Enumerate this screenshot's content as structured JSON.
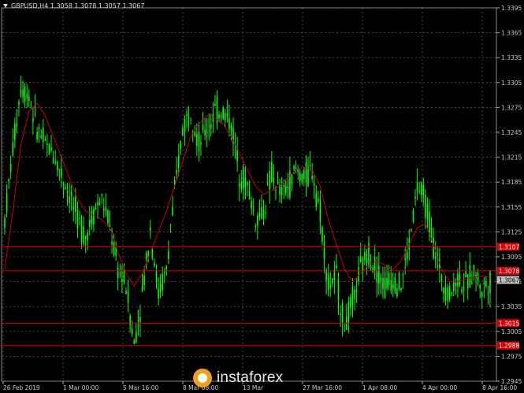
{
  "symbol": {
    "name": "GBPUSD,H4",
    "open": "1.3058",
    "high": "1.3078",
    "low": "1.3057",
    "close": "1.3067"
  },
  "watermark": "instaforex",
  "colors": {
    "background": "#000000",
    "grid": "#707070",
    "candle": "#00ff00",
    "ma": "#cc0000",
    "level_line": "#e00000",
    "level_tag": "#dd0000",
    "price_tag": "#c0c0c0",
    "axis_text": "#c8c8c8"
  },
  "chart_data": {
    "type": "line",
    "ylim": [
      1.2945,
      1.3395
    ],
    "y_ticks": [
      "1.3395",
      "1.3365",
      "1.3335",
      "1.3305",
      "1.3275",
      "1.3245",
      "1.3215",
      "1.3185",
      "1.3155",
      "1.3125",
      "1.3095",
      "1.3065",
      "1.3035",
      "1.3005",
      "1.2975",
      "1.2945"
    ],
    "x_ticks": [
      "26 Feb 2019",
      "1 Mar 00:00",
      "5 Mar 16:00",
      "8 Mar 08:00",
      "13 Mar",
      "27 Mar 16:00",
      "1 Apr 08:00",
      "4 Apr 00:00",
      "8 Apr 16:00"
    ],
    "grid": true,
    "levels": [
      {
        "value": 1.3107,
        "label": "1.3107"
      },
      {
        "value": 1.3078,
        "label": "1.3078"
      },
      {
        "value": 1.3015,
        "label": "1.3015"
      },
      {
        "value": 1.2988,
        "label": "1.2988"
      }
    ],
    "current_price": {
      "value": 1.3067,
      "label": "1.3067"
    },
    "price_path": [
      [
        0,
        1.314
      ],
      [
        4,
        1.3225
      ],
      [
        8,
        1.33
      ],
      [
        12,
        1.329
      ],
      [
        16,
        1.325
      ],
      [
        20,
        1.323
      ],
      [
        24,
        1.322
      ],
      [
        28,
        1.3195
      ],
      [
        32,
        1.317
      ],
      [
        36,
        1.314
      ],
      [
        40,
        1.312
      ],
      [
        44,
        1.315
      ],
      [
        48,
        1.3165
      ],
      [
        52,
        1.313
      ],
      [
        56,
        1.308
      ],
      [
        60,
        1.306
      ],
      [
        64,
        1.299
      ],
      [
        68,
        1.305
      ],
      [
        72,
        1.313
      ],
      [
        76,
        1.305
      ],
      [
        80,
        1.308
      ],
      [
        84,
        1.317
      ],
      [
        88,
        1.325
      ],
      [
        92,
        1.3275
      ],
      [
        96,
        1.323
      ],
      [
        100,
        1.325
      ],
      [
        104,
        1.327
      ],
      [
        108,
        1.327
      ],
      [
        112,
        1.3255
      ],
      [
        116,
        1.32
      ],
      [
        120,
        1.318
      ],
      [
        124,
        1.314
      ],
      [
        128,
        1.315
      ],
      [
        132,
        1.3195
      ],
      [
        136,
        1.317
      ],
      [
        140,
        1.318
      ],
      [
        144,
        1.32
      ],
      [
        148,
        1.319
      ],
      [
        152,
        1.32
      ],
      [
        156,
        1.315
      ],
      [
        160,
        1.306
      ],
      [
        164,
        1.307
      ],
      [
        168,
        1.301
      ],
      [
        172,
        1.304
      ],
      [
        176,
        1.308
      ],
      [
        180,
        1.31
      ],
      [
        184,
        1.308
      ],
      [
        188,
        1.306
      ],
      [
        192,
        1.307
      ],
      [
        196,
        1.306
      ],
      [
        200,
        1.311
      ],
      [
        204,
        1.318
      ],
      [
        208,
        1.316
      ],
      [
        212,
        1.311
      ],
      [
        216,
        1.307
      ],
      [
        220,
        1.305
      ],
      [
        224,
        1.307
      ],
      [
        228,
        1.306
      ],
      [
        232,
        1.308
      ],
      [
        236,
        1.3055
      ],
      [
        240,
        1.3067
      ]
    ],
    "ma_path": [
      [
        0,
        1.308
      ],
      [
        4,
        1.315
      ],
      [
        8,
        1.323
      ],
      [
        12,
        1.327
      ],
      [
        16,
        1.328
      ],
      [
        20,
        1.3265
      ],
      [
        24,
        1.324
      ],
      [
        28,
        1.3215
      ],
      [
        32,
        1.319
      ],
      [
        36,
        1.3165
      ],
      [
        40,
        1.315
      ],
      [
        44,
        1.3145
      ],
      [
        48,
        1.314
      ],
      [
        52,
        1.313
      ],
      [
        56,
        1.31
      ],
      [
        60,
        1.3075
      ],
      [
        64,
        1.306
      ],
      [
        68,
        1.3075
      ],
      [
        72,
        1.31
      ],
      [
        76,
        1.3125
      ],
      [
        80,
        1.315
      ],
      [
        84,
        1.318
      ],
      [
        88,
        1.321
      ],
      [
        92,
        1.324
      ],
      [
        96,
        1.3255
      ],
      [
        100,
        1.3265
      ],
      [
        104,
        1.3262
      ],
      [
        108,
        1.3255
      ],
      [
        112,
        1.324
      ],
      [
        116,
        1.322
      ],
      [
        120,
        1.32
      ],
      [
        124,
        1.318
      ],
      [
        128,
        1.317
      ],
      [
        132,
        1.3175
      ],
      [
        136,
        1.318
      ],
      [
        140,
        1.319
      ],
      [
        144,
        1.32
      ],
      [
        148,
        1.3203
      ],
      [
        152,
        1.32
      ],
      [
        156,
        1.318
      ],
      [
        160,
        1.314
      ],
      [
        164,
        1.311
      ],
      [
        168,
        1.308
      ],
      [
        172,
        1.3065
      ],
      [
        176,
        1.3075
      ],
      [
        180,
        1.3085
      ],
      [
        184,
        1.309
      ],
      [
        188,
        1.3085
      ],
      [
        192,
        1.308
      ],
      [
        196,
        1.309
      ],
      [
        200,
        1.311
      ],
      [
        204,
        1.313
      ],
      [
        208,
        1.3135
      ],
      [
        212,
        1.311
      ],
      [
        216,
        1.308
      ],
      [
        220,
        1.3065
      ],
      [
        224,
        1.3065
      ],
      [
        228,
        1.3068
      ],
      [
        232,
        1.307
      ],
      [
        236,
        1.3072
      ],
      [
        240,
        1.307
      ]
    ]
  }
}
